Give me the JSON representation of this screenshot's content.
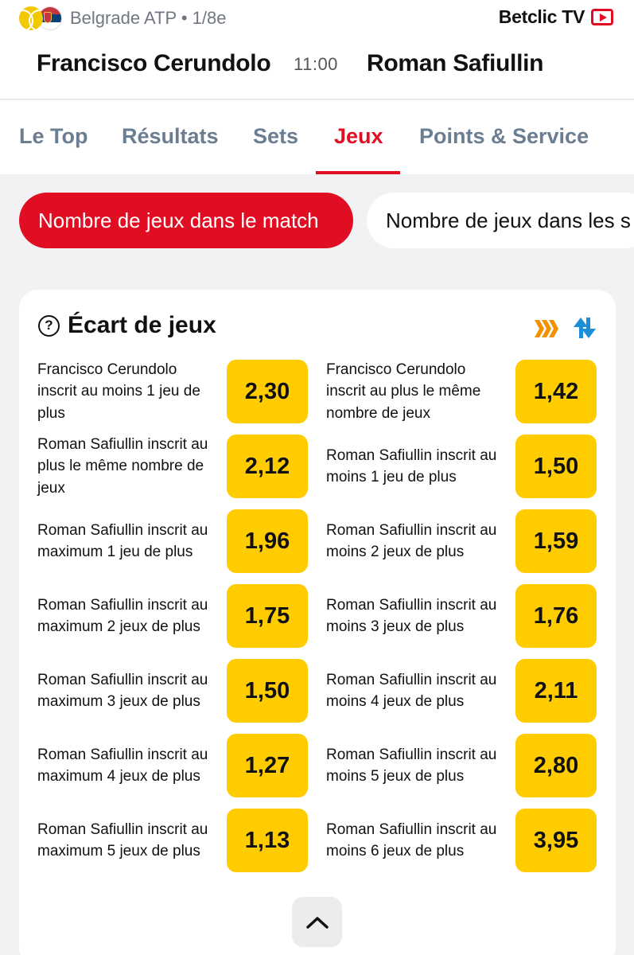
{
  "header": {
    "event_name": "Belgrade ATP • 1/8e",
    "tv_label": "Betclic TV",
    "home_player": "Francisco Cerundolo",
    "time": "11:00",
    "away_player": "Roman Safiullin"
  },
  "tabs": [
    {
      "label": "Le Top",
      "active": false
    },
    {
      "label": "Résultats",
      "active": false
    },
    {
      "label": "Sets",
      "active": false
    },
    {
      "label": "Jeux",
      "active": true
    },
    {
      "label": "Points & Service",
      "active": false
    }
  ],
  "chips": [
    {
      "label": "Nombre de jeux dans le match",
      "active": true
    },
    {
      "label": "Nombre de jeux dans les s",
      "active": false
    }
  ],
  "market": {
    "help_icon": "?",
    "title": "Écart de jeux",
    "icons": [
      "boost-icon",
      "swap-icon"
    ],
    "rows": [
      {
        "left": {
          "label": "Francisco Cerundolo inscrit au moins 1 jeu de plus",
          "odd": "2,30"
        },
        "right": {
          "label": "Francisco Cerundolo inscrit au plus le même nombre de jeux",
          "odd": "1,42"
        }
      },
      {
        "left": {
          "label": "Roman Safiullin inscrit au plus le même nombre de jeux",
          "odd": "2,12"
        },
        "right": {
          "label": "Roman Safiullin inscrit au moins 1 jeu de plus",
          "odd": "1,50"
        }
      },
      {
        "left": {
          "label": "Roman Safiullin inscrit au maximum 1 jeu de plus",
          "odd": "1,96"
        },
        "right": {
          "label": "Roman Safiullin inscrit au moins 2 jeux de plus",
          "odd": "1,59"
        }
      },
      {
        "left": {
          "label": "Roman Safiullin inscrit au maximum 2 jeux de plus",
          "odd": "1,75"
        },
        "right": {
          "label": "Roman Safiullin inscrit au moins 3 jeux de plus",
          "odd": "1,76"
        }
      },
      {
        "left": {
          "label": "Roman Safiullin inscrit au maximum 3 jeux de plus",
          "odd": "1,50"
        },
        "right": {
          "label": "Roman Safiullin inscrit au moins 4 jeux de plus",
          "odd": "2,11"
        }
      },
      {
        "left": {
          "label": "Roman Safiullin inscrit au maximum 4 jeux de plus",
          "odd": "1,27"
        },
        "right": {
          "label": "Roman Safiullin inscrit au moins 5 jeux de plus",
          "odd": "2,80"
        }
      },
      {
        "left": {
          "label": "Roman Safiullin inscrit au maximum 5 jeux de plus",
          "odd": "1,13"
        },
        "right": {
          "label": "Roman Safiullin inscrit au moins 6 jeux de plus",
          "odd": "3,95"
        }
      }
    ]
  },
  "colors": {
    "accent_red": "#e10e23",
    "odds_yellow": "#ffcc00",
    "boost_orange": "#f39200",
    "swap_blue": "#1a8fd8"
  }
}
